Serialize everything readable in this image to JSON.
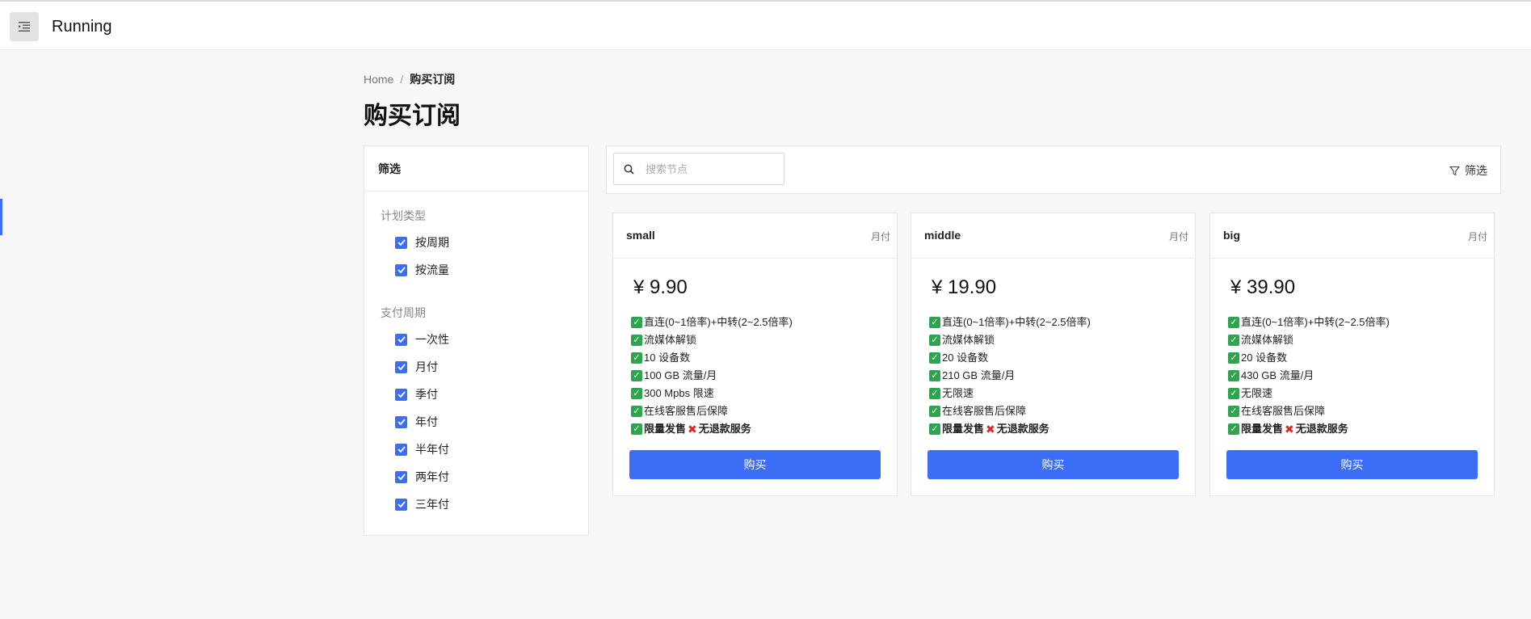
{
  "app": {
    "title": "Running"
  },
  "breadcrumb": {
    "home": "Home",
    "sep": "/",
    "current": "购买订阅"
  },
  "page": {
    "title": "购买订阅"
  },
  "filter": {
    "title": "筛选",
    "groups": [
      {
        "label": "计划类型",
        "options": [
          "按周期",
          "按流量"
        ]
      },
      {
        "label": "支付周期",
        "options": [
          "一次性",
          "月付",
          "季付",
          "年付",
          "半年付",
          "两年付",
          "三年付"
        ]
      }
    ]
  },
  "toolbar": {
    "search_placeholder": "搜索节点",
    "filter_label": "筛选"
  },
  "colors": {
    "accent": "#3b6ef5",
    "check_green": "#2ea44f",
    "cross_red": "#d62b2b"
  },
  "plans": [
    {
      "name": "small",
      "period": "月付",
      "price": "¥ 9.90",
      "features": [
        "直连(0~1倍率)+中转(2~2.5倍率)",
        "流媒体解锁",
        "10 设备数",
        "100 GB 流量/月",
        "300 Mpbs 限速",
        "在线客服售后保障"
      ],
      "promo_a": "限量发售",
      "promo_b": "无退款服务",
      "buy_label": "购买"
    },
    {
      "name": "middle",
      "period": "月付",
      "price": "¥ 19.90",
      "features": [
        "直连(0~1倍率)+中转(2~2.5倍率)",
        "流媒体解锁",
        "20 设备数",
        "210 GB 流量/月",
        "无限速",
        "在线客服售后保障"
      ],
      "promo_a": "限量发售",
      "promo_b": "无退款服务",
      "buy_label": "购买"
    },
    {
      "name": "big",
      "period": "月付",
      "price": "¥ 39.90",
      "features": [
        "直连(0~1倍率)+中转(2~2.5倍率)",
        "流媒体解锁",
        "20 设备数",
        "430 GB 流量/月",
        "无限速",
        "在线客服售后保障"
      ],
      "promo_a": "限量发售",
      "promo_b": "无退款服务",
      "buy_label": "购买"
    }
  ]
}
